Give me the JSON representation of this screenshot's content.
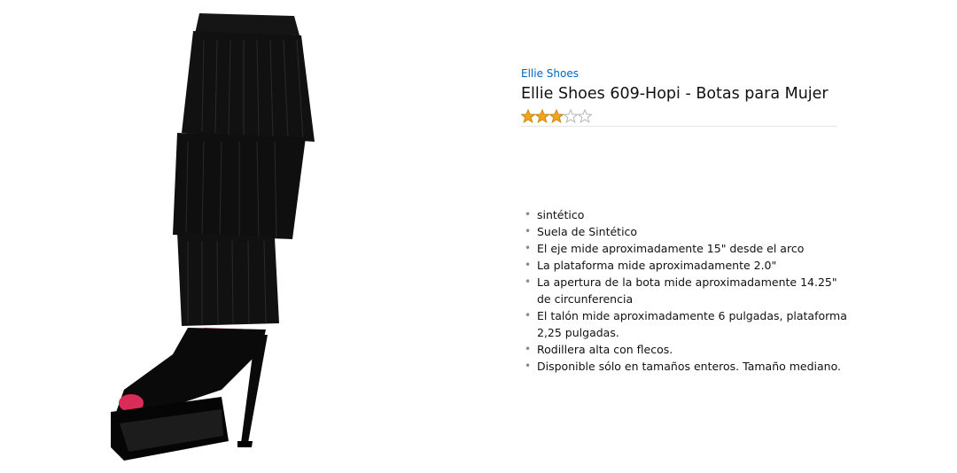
{
  "product": {
    "brand": "Ellie Shoes",
    "title": "Ellie Shoes 609-Hopi - Botas para Mujer",
    "rating": 3,
    "rating_max": 5,
    "star_color": "#f4a41c",
    "image_icon": "fringe-knee-boot-image",
    "features": [
      "sintético",
      "Suela de Sintético",
      "El eje mide aproximadamente 15\" desde el arco",
      "La plataforma mide aproximadamente 2.0\"",
      "La apertura de la bota mide aproximadamente 14.25\" de circunferencia",
      "El talón mide aproximadamente 6 pulgadas, plataforma 2,25 pulgadas.",
      "Rodillera alta con flecos.",
      "Disponible sólo en tamaños enteros. Tamaño mediano."
    ]
  }
}
